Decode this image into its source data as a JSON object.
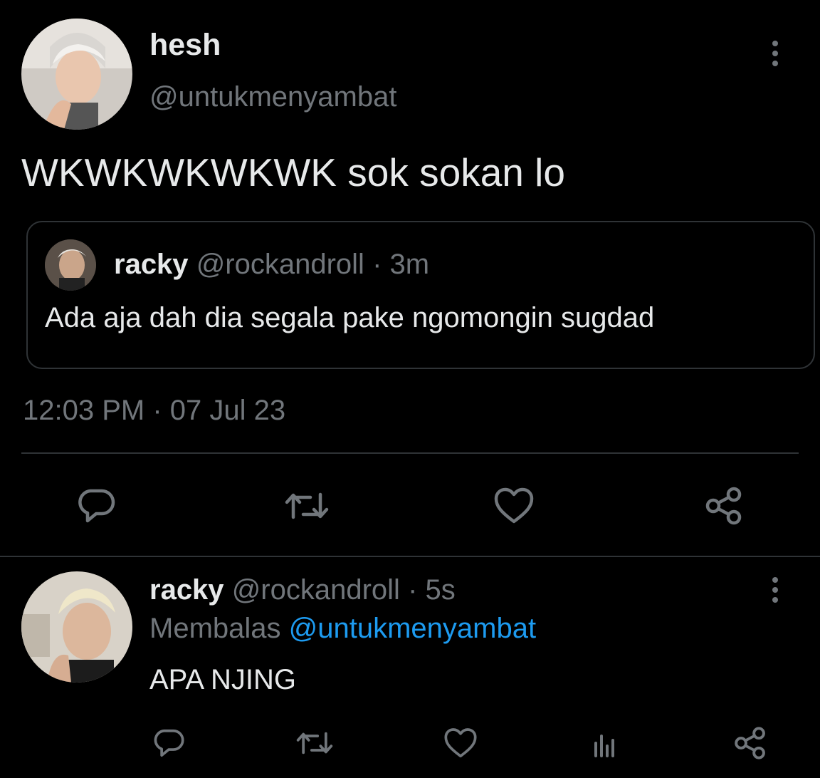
{
  "main_tweet": {
    "author_name": "hesh",
    "author_handle": "@untukmenyambat",
    "text": "WKWKWKWKWK sok sokan lo",
    "timestamp": "12:03 PM · 07 Jul 23"
  },
  "quoted_tweet": {
    "author_name": "racky",
    "author_handle": "@rockandroll",
    "meta": "· 3m",
    "text": "Ada aja dah dia segala pake ngomongin sugdad"
  },
  "actions": {
    "icons": [
      "reply-icon",
      "retweet-icon",
      "like-icon",
      "share-icon"
    ]
  },
  "reply": {
    "author_name": "racky",
    "author_handle": "@rockandroll",
    "meta": "· 5s",
    "replying_prefix": "Membalas",
    "replying_to": "@untukmenyambat",
    "text": "APA NJING",
    "icons": [
      "reply-icon",
      "retweet-icon",
      "like-icon",
      "analytics-icon",
      "share-icon"
    ]
  },
  "colors": {
    "background": "#000000",
    "text": "#e7e9ea",
    "muted": "#71767b",
    "link": "#1d9bf0",
    "border": "#2f3336"
  }
}
